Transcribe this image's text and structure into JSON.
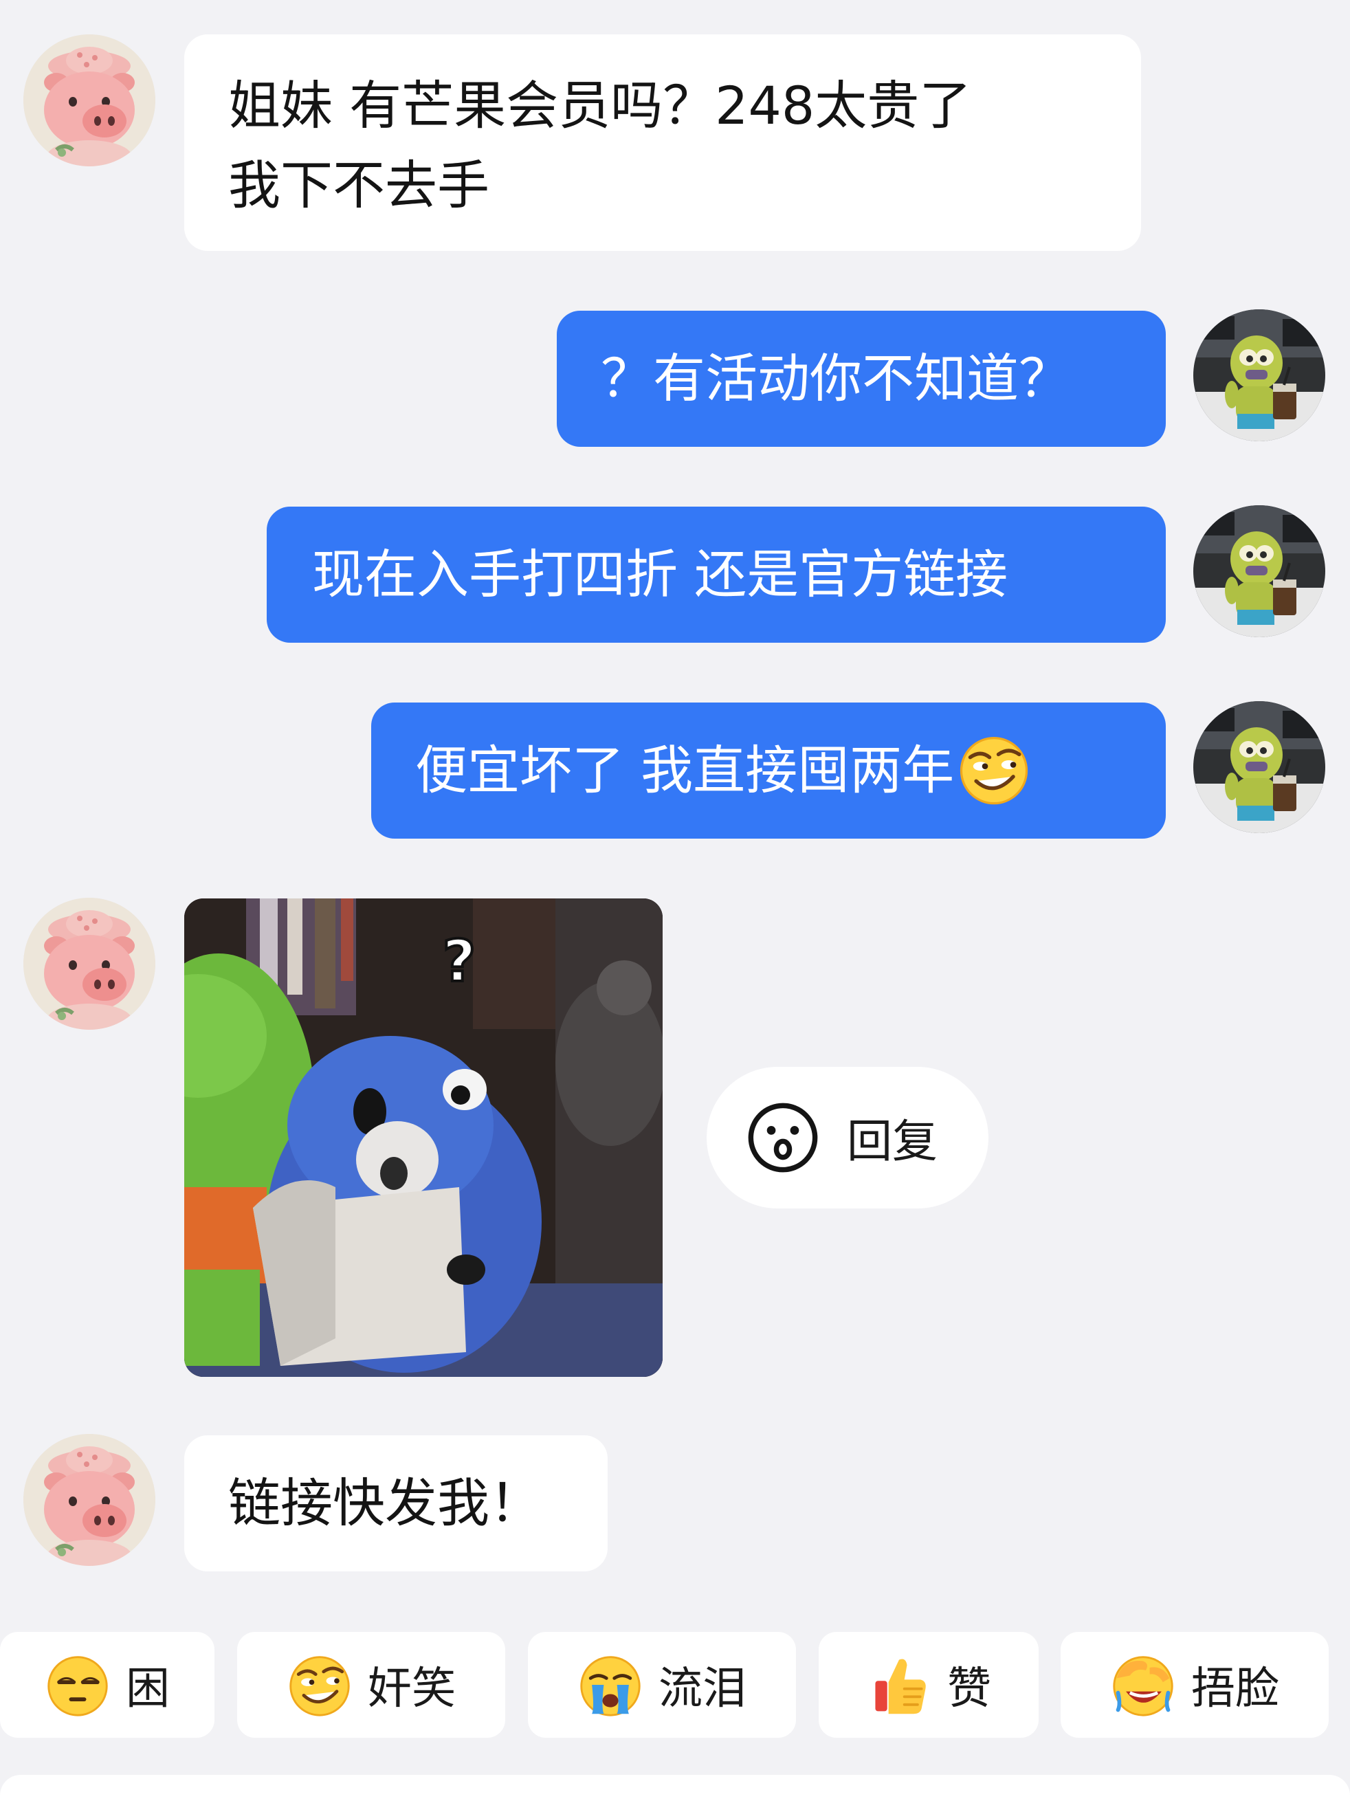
{
  "messages": [
    {
      "side": "in",
      "lines": [
        "姐妹 有芒果会员吗？248太贵了",
        "我下不去手"
      ]
    },
    {
      "side": "out",
      "text": "？有活动你不知道？"
    },
    {
      "side": "out",
      "text": "现在入手打四折 还是官方链接"
    },
    {
      "side": "out",
      "text": "便宜坏了 我直接囤两年",
      "emoji": "smirk-emoji"
    },
    {
      "side": "in",
      "type": "sticker",
      "sticker_text": "?"
    },
    {
      "side": "in",
      "text": "链接快发我！"
    }
  ],
  "reply_button": {
    "label": "回复",
    "icon": "smiley-face-icon"
  },
  "quick_reactions": [
    {
      "label": "困",
      "icon": "sleepy-emoji"
    },
    {
      "label": "奸笑",
      "icon": "smirk-emoji"
    },
    {
      "label": "流泪",
      "icon": "crying-emoji"
    },
    {
      "label": "赞",
      "icon": "thumbs-up-emoji"
    },
    {
      "label": "捂脸",
      "icon": "facepalm-emoji"
    }
  ],
  "colors": {
    "background": "#F2F2F5",
    "outgoing_bubble": "#3478F6",
    "incoming_bubble": "#FFFFFF"
  }
}
